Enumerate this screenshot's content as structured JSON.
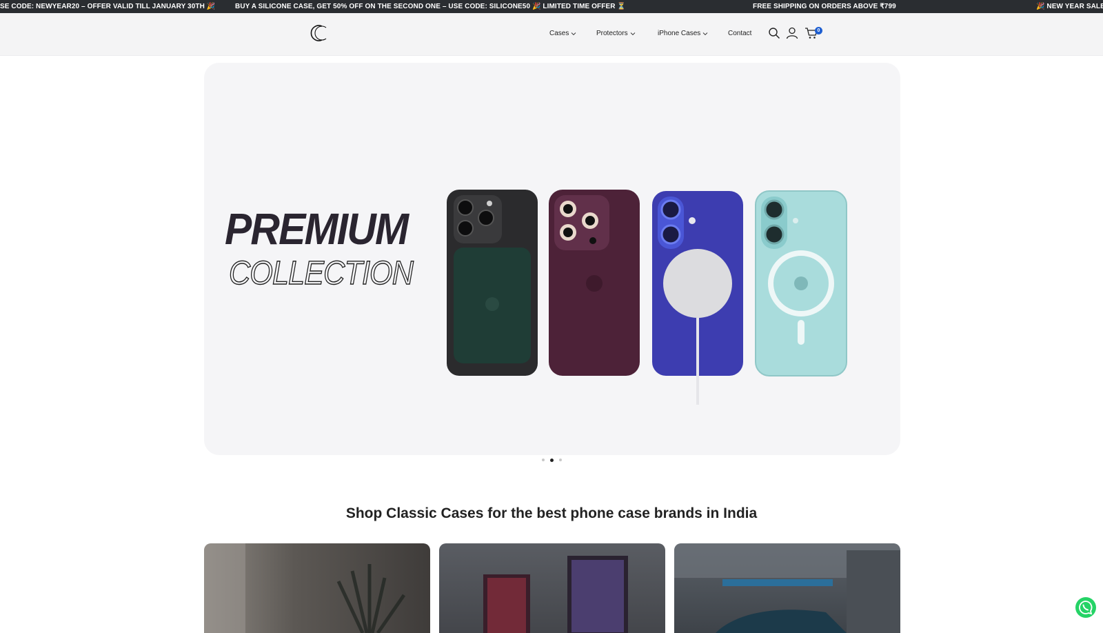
{
  "announcement": {
    "items": [
      "SE CODE: NEWYEAR20 – OFFER VALID TILL JANUARY 30TH 🎉",
      "BUY A SILICONE CASE, GET 50% OFF ON THE SECOND ONE – USE CODE: SILICONE50 🎉  LIMITED TIME OFFER ⏳",
      "FREE SHIPPING ON ORDERS ABOVE ₹799",
      "🎉  NEW YEAR SALE C"
    ]
  },
  "nav": {
    "items": [
      "Cases",
      "Protectors",
      "iPhone Cases",
      "Contact"
    ]
  },
  "cart": {
    "count": "0"
  },
  "hero": {
    "headline": "PREMIUM",
    "subheadline": "COLLECTION",
    "slides_total": 3,
    "active_slide": 2
  },
  "section": {
    "title": "Shop Classic Cases for the best phone case brands in India"
  },
  "colors": {
    "announcement_bg": "#2a2d31",
    "header_bg": "#f4f4f5",
    "hero_bg": "#f5f5f7",
    "badge": "#1f5fd1",
    "whatsapp": "#25d366"
  },
  "icons": [
    "logo-icon",
    "search-icon",
    "user-icon",
    "cart-icon",
    "chevron-down-icon",
    "whatsapp-icon"
  ]
}
